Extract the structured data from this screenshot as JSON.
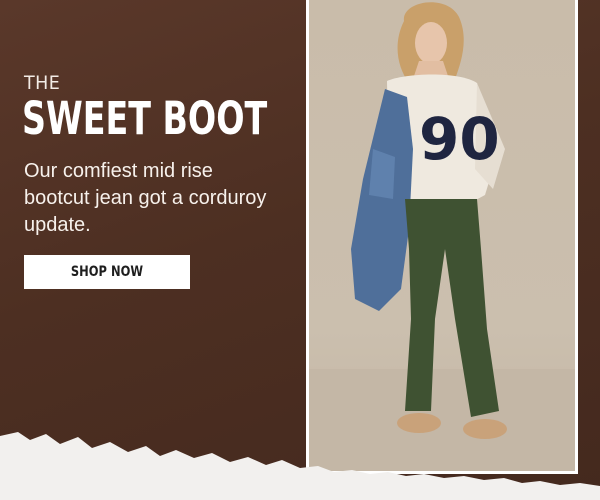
{
  "banner": {
    "eyebrow": "THE",
    "headline": "SWEET BOOT",
    "body": "Our comfiest mid rise bootcut jean got a corduroy update.",
    "cta_label": "SHOP NOW",
    "sweater_number": "90"
  },
  "colors": {
    "background": "#4d2f22",
    "cta_background": "#ffffff",
    "cta_text": "#1e1e1e",
    "corduroy_pants": "#3f5232",
    "sweater": "#efe9df",
    "denim_jacket": "#4f6f9a"
  }
}
